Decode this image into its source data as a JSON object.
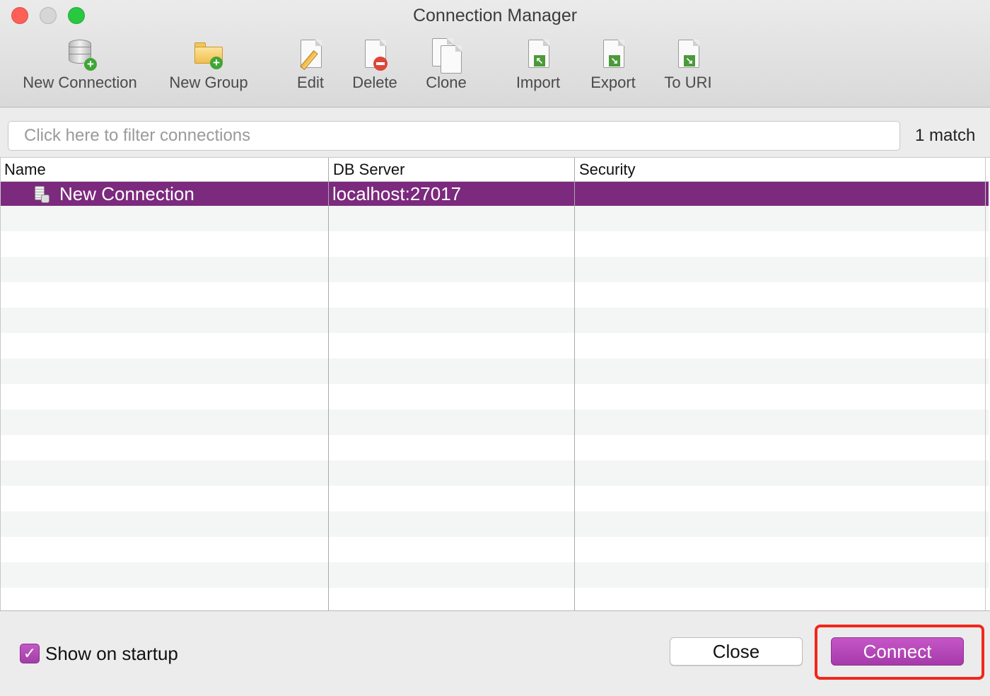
{
  "window": {
    "title": "Connection Manager"
  },
  "toolbar": {
    "items": [
      {
        "label": "New Connection",
        "icon": "database-add-icon"
      },
      {
        "label": "New Group",
        "icon": "folder-add-icon"
      },
      {
        "label": "Edit",
        "icon": "edit-pencil-icon"
      },
      {
        "label": "Delete",
        "icon": "delete-doc-icon"
      },
      {
        "label": "Clone",
        "icon": "clone-docs-icon"
      },
      {
        "label": "Import",
        "icon": "import-doc-icon"
      },
      {
        "label": "Export",
        "icon": "export-doc-icon"
      },
      {
        "label": "To URI",
        "icon": "to-uri-doc-icon"
      }
    ]
  },
  "filter": {
    "placeholder": "Click here to filter connections",
    "value": ""
  },
  "match_count": "1 match",
  "table": {
    "columns": [
      "Name",
      "DB Server",
      "Security"
    ],
    "rows": [
      {
        "name": "New Connection",
        "server": "localhost:27017",
        "security": "",
        "selected": true
      }
    ]
  },
  "footer": {
    "show_on_startup": {
      "label": "Show on startup",
      "checked": true
    },
    "close_label": "Close",
    "connect_label": "Connect"
  },
  "colors": {
    "accent": "#7b2a7d",
    "button_accent": "#b247b5",
    "highlight": "#f2271c"
  }
}
